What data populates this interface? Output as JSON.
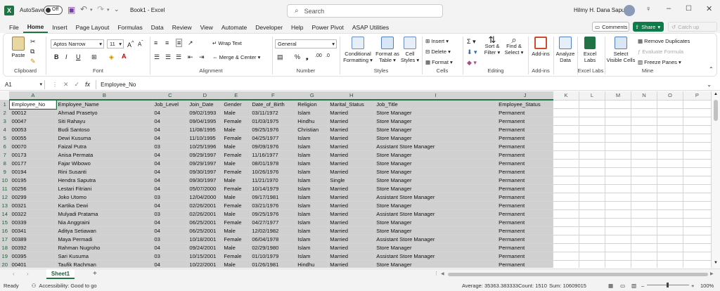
{
  "titlebar": {
    "autosave_label": "AutoSave",
    "autosave_state": "Off",
    "file_title": "Book1  -  Excel",
    "search_placeholder": "Search",
    "user_name": "Hilmy H. Dana Saputra"
  },
  "menu": [
    "File",
    "Home",
    "Insert",
    "Page Layout",
    "Formulas",
    "Data",
    "Review",
    "View",
    "Automate",
    "Developer",
    "Help",
    "Power Pivot",
    "ASAP Utilities"
  ],
  "menu_right": {
    "comments": "Comments",
    "share": "Share",
    "catchup": "Catch up"
  },
  "ribbon": {
    "clipboard": {
      "paste": "Paste",
      "label": "Clipboard"
    },
    "font": {
      "name": "Aptos Narrow",
      "size": "11",
      "label": "Font"
    },
    "alignment": {
      "wrap": "Wrap Text",
      "merge": "Merge & Center",
      "label": "Alignment"
    },
    "number": {
      "format": "General",
      "label": "Number"
    },
    "styles": {
      "cond": "Conditional Formatting",
      "cond1": "Conditional",
      "cond2": "Formatting",
      "fmt1": "Format as",
      "fmt2": "Table",
      "cell1": "Cell",
      "cell2": "Styles",
      "label": "Styles"
    },
    "cells": {
      "insert": "Insert",
      "delete": "Delete",
      "format": "Format",
      "label": "Cells"
    },
    "editing": {
      "sort1": "Sort &",
      "sort2": "Filter",
      "find1": "Find &",
      "find2": "Select",
      "label": "Editing"
    },
    "addins": {
      "btn": "Add-ins",
      "label": "Add-ins"
    },
    "analyze": {
      "btn1": "Analyze",
      "btn2": "Data"
    },
    "excellabs": {
      "btn1": "Excel",
      "btn2": "Labs",
      "label": "Excel Labs"
    },
    "mine": {
      "select1": "Select",
      "select2": "Visible Cells",
      "remove": "Remove Duplicates",
      "evaluate": "Evaluate Formula",
      "freeze": "Freeze Panes",
      "label": "Mine"
    }
  },
  "formula": {
    "namebox": "A1",
    "fx": "fx",
    "content": "Employee_No"
  },
  "columns": [
    "A",
    "B",
    "C",
    "D",
    "E",
    "F",
    "G",
    "H",
    "I",
    "J",
    "K",
    "L",
    "M",
    "N",
    "O",
    "P"
  ],
  "headers": [
    "Employee_No",
    "Employee_Name",
    "Job_Level",
    "Join_Date",
    "Gender",
    "Date_of_Birth",
    "Religion",
    "Marital_Status",
    "Job_Title",
    "Employee_Status"
  ],
  "rows": [
    [
      "00012",
      "Ahmad Prasetyo",
      "04",
      "09/02/1993",
      "Male",
      "03/11/1972",
      "Islam",
      "Married",
      "Store Manager",
      "Permanent"
    ],
    [
      "00047",
      "Siti Rahayu",
      "04",
      "09/04/1995",
      "Female",
      "01/03/1975",
      "Hindhu",
      "Married",
      "Store Manager",
      "Permanent"
    ],
    [
      "00053",
      "Budi Santoso",
      "04",
      "11/08/1995",
      "Male",
      "09/25/1976",
      "Christian",
      "Married",
      "Store Manager",
      "Permanent"
    ],
    [
      "00055",
      "Dewi Kusuma",
      "04",
      "11/10/1995",
      "Female",
      "04/25/1977",
      "Islam",
      "Married",
      "Store Manager",
      "Permanent"
    ],
    [
      "00070",
      "Faizal Putra",
      "03",
      "10/25/1996",
      "Male",
      "09/09/1976",
      "Islam",
      "Married",
      "Assistant Store Manager",
      "Permanent"
    ],
    [
      "00173",
      "Anisa Permata",
      "04",
      "09/29/1997",
      "Female",
      "11/16/1977",
      "Islam",
      "Married",
      "Store Manager",
      "Permanent"
    ],
    [
      "00177",
      "Fajar Wibowo",
      "04",
      "09/29/1997",
      "Male",
      "08/01/1978",
      "Islam",
      "Married",
      "Store Manager",
      "Permanent"
    ],
    [
      "00194",
      "Rini Susanti",
      "04",
      "09/30/1997",
      "Female",
      "10/26/1976",
      "Islam",
      "Married",
      "Store Manager",
      "Permanent"
    ],
    [
      "00195",
      "Hendra Saputra",
      "04",
      "09/30/1997",
      "Male",
      "11/21/1970",
      "Islam",
      "Single",
      "Store Manager",
      "Permanent"
    ],
    [
      "00256",
      "Lestari Fitriani",
      "04",
      "05/07/2000",
      "Female",
      "10/14/1979",
      "Islam",
      "Married",
      "Store Manager",
      "Permanent"
    ],
    [
      "00299",
      "Joko Utomo",
      "03",
      "12/04/2000",
      "Male",
      "09/17/1981",
      "Islam",
      "Married",
      "Assistant Store Manager",
      "Permanent"
    ],
    [
      "00321",
      "Kartika Dewi",
      "04",
      "02/26/2001",
      "Female",
      "03/21/1976",
      "Islam",
      "Married",
      "Store Manager",
      "Permanent"
    ],
    [
      "00322",
      "Mulyadi Pratama",
      "03",
      "02/26/2001",
      "Male",
      "09/25/1976",
      "Islam",
      "Married",
      "Assistant Store Manager",
      "Permanent"
    ],
    [
      "00339",
      "Nia Anggraini",
      "04",
      "06/25/2001",
      "Female",
      "04/27/1977",
      "Islam",
      "Married",
      "Store Manager",
      "Permanent"
    ],
    [
      "00341",
      "Aditya Setiawan",
      "04",
      "06/25/2001",
      "Male",
      "12/02/1982",
      "Islam",
      "Married",
      "Store Manager",
      "Permanent"
    ],
    [
      "00389",
      "Maya Permadi",
      "03",
      "10/18/2001",
      "Female",
      "06/04/1978",
      "Islam",
      "Married",
      "Assistant Store Manager",
      "Permanent"
    ],
    [
      "00392",
      "Rahman Nugroho",
      "04",
      "09/24/2001",
      "Male",
      "02/29/1980",
      "Islam",
      "Married",
      "Store Manager",
      "Permanent"
    ],
    [
      "00395",
      "Sari Kusuma",
      "03",
      "10/15/2001",
      "Female",
      "01/10/1979",
      "Islam",
      "Married",
      "Assistant Store Manager",
      "Permanent"
    ],
    [
      "00401",
      "Taufik Rachman",
      "04",
      "10/22/2001",
      "Male",
      "01/26/1981",
      "Hindhu",
      "Married",
      "Store Manager",
      "Permanent"
    ]
  ],
  "sheet_tab": "Sheet1",
  "status": {
    "ready": "Ready",
    "accessibility": "Accessibility: Good to go",
    "average": "Average: 35363.383333",
    "count": "Count: 1510",
    "sum": "Sum: 10609015",
    "zoom": "100%"
  },
  "colors": {
    "accent": "#217346",
    "share": "#0f7b4a",
    "selection": "#d0d0d0"
  }
}
